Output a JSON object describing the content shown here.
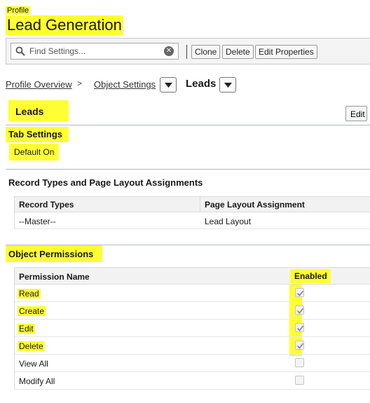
{
  "header": {
    "profile_label": "Profile",
    "title": "Lead Generation"
  },
  "toolbar": {
    "search_placeholder": "Find Settings...",
    "clone_label": "Clone",
    "delete_label": "Delete",
    "edit_properties_label": "Edit Properties"
  },
  "breadcrumb": {
    "profile_overview": "Profile Overview",
    "separator": ">",
    "object_settings": "Object Settings",
    "current": "Leads"
  },
  "leads_section": {
    "title": "Leads",
    "edit_label": "Edit"
  },
  "tab_settings": {
    "title": "Tab Settings",
    "value": "Default On"
  },
  "record_types": {
    "title": "Record Types and Page Layout Assignments",
    "columns": [
      "Record Types",
      "Page Layout Assignment"
    ],
    "rows": [
      [
        "--Master--",
        "Lead Layout"
      ]
    ]
  },
  "object_permissions": {
    "title": "Object Permissions",
    "columns": [
      "Permission Name",
      "Enabled"
    ],
    "rows": [
      {
        "name": "Read",
        "enabled": true,
        "highlighted": true
      },
      {
        "name": "Create",
        "enabled": true,
        "highlighted": true
      },
      {
        "name": "Edit",
        "enabled": true,
        "highlighted": true
      },
      {
        "name": "Delete",
        "enabled": true,
        "highlighted": true
      },
      {
        "name": "View All",
        "enabled": false,
        "highlighted": false
      },
      {
        "name": "Modify All",
        "enabled": false,
        "highlighted": false
      }
    ]
  },
  "colors": {
    "highlight": "#ffff33",
    "rule": "#b0bac5",
    "header_bg": "#f2f2f2"
  }
}
